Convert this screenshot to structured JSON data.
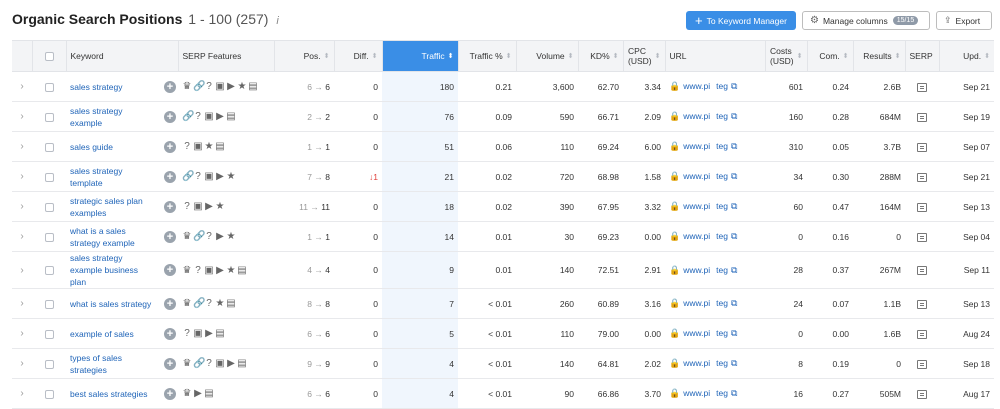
{
  "header": {
    "title": "Organic Search Positions",
    "range": "1 - 100 (257)",
    "info_icon": "i",
    "keyword_manager_label": "To Keyword Manager",
    "manage_columns_label": "Manage columns",
    "manage_columns_count": "15/15",
    "export_label": "Export"
  },
  "columns": {
    "keyword": "Keyword",
    "serp_features": "SERP Features",
    "pos": "Pos.",
    "diff": "Diff.",
    "traffic": "Traffic",
    "traffic_pct": "Traffic %",
    "volume": "Volume",
    "kd": "KD%",
    "cpc_line1": "CPC",
    "cpc_line2": "(USD)",
    "url": "URL",
    "costs_line1": "Costs",
    "costs_line2": "(USD)",
    "com": "Com.",
    "results": "Results",
    "serp": "SERP",
    "upd": "Upd."
  },
  "rows": [
    {
      "keyword": "sales strategy",
      "features": [
        "crown",
        "link",
        "question",
        "image",
        "play",
        "star",
        "serp-box"
      ],
      "pos_prev": "6",
      "arrow": "→",
      "pos_cur": "6",
      "diff": "0",
      "diff_dir": "none",
      "traffic": "180",
      "traffic_pct": "0.21",
      "volume": "3,600",
      "kd": "62.70",
      "cpc": "3.34",
      "url_a": "www.pi",
      "url_b": "teg",
      "costs": "601",
      "com": "0.24",
      "results": "2.6B",
      "upd": "Sep 21"
    },
    {
      "keyword": "sales strategy example",
      "features": [
        "link",
        "question",
        "image",
        "play",
        "serp-box"
      ],
      "pos_prev": "2",
      "arrow": "→",
      "pos_cur": "2",
      "diff": "0",
      "diff_dir": "none",
      "traffic": "76",
      "traffic_pct": "0.09",
      "volume": "590",
      "kd": "66.71",
      "cpc": "2.09",
      "url_a": "www.pi",
      "url_b": "teg",
      "costs": "160",
      "com": "0.28",
      "results": "684M",
      "upd": "Sep 19"
    },
    {
      "keyword": "sales guide",
      "features": [
        "question",
        "image",
        "star",
        "serp-box"
      ],
      "pos_prev": "1",
      "arrow": "→",
      "pos_cur": "1",
      "diff": "0",
      "diff_dir": "none",
      "traffic": "51",
      "traffic_pct": "0.06",
      "volume": "110",
      "kd": "69.24",
      "cpc": "6.00",
      "url_a": "www.pi",
      "url_b": "teg",
      "costs": "310",
      "com": "0.05",
      "results": "3.7B",
      "upd": "Sep 07"
    },
    {
      "keyword": "sales strategy template",
      "features": [
        "link",
        "question",
        "image",
        "play",
        "star"
      ],
      "pos_prev": "7",
      "arrow": "→",
      "pos_cur": "8",
      "diff": "↓1",
      "diff_dir": "down",
      "traffic": "21",
      "traffic_pct": "0.02",
      "volume": "720",
      "kd": "68.98",
      "cpc": "1.58",
      "url_a": "www.pi",
      "url_b": "teg",
      "costs": "34",
      "com": "0.30",
      "results": "288M",
      "upd": "Sep 21"
    },
    {
      "keyword": "strategic sales plan examples",
      "features": [
        "question",
        "image",
        "play",
        "star"
      ],
      "pos_prev": "11",
      "arrow": "→",
      "pos_cur": "11",
      "diff": "0",
      "diff_dir": "none",
      "traffic": "18",
      "traffic_pct": "0.02",
      "volume": "390",
      "kd": "67.95",
      "cpc": "3.32",
      "url_a": "www.pi",
      "url_b": "teg",
      "costs": "60",
      "com": "0.47",
      "results": "164M",
      "upd": "Sep 13"
    },
    {
      "keyword": "what is a sales strategy example",
      "features": [
        "crown",
        "link",
        "question",
        "play",
        "star"
      ],
      "pos_prev": "1",
      "arrow": "→",
      "pos_cur": "1",
      "diff": "0",
      "diff_dir": "none",
      "traffic": "14",
      "traffic_pct": "0.01",
      "volume": "30",
      "kd": "69.23",
      "cpc": "0.00",
      "url_a": "www.pi",
      "url_b": "teg",
      "costs": "0",
      "com": "0.16",
      "results": "0",
      "upd": "Sep 04"
    },
    {
      "keyword": "sales strategy example business plan",
      "features": [
        "crown",
        "question",
        "image",
        "play",
        "star",
        "serp-box"
      ],
      "pos_prev": "4",
      "arrow": "→",
      "pos_cur": "4",
      "diff": "0",
      "diff_dir": "none",
      "traffic": "9",
      "traffic_pct": "0.01",
      "volume": "140",
      "kd": "72.51",
      "cpc": "2.91",
      "url_a": "www.pi",
      "url_b": "teg",
      "costs": "28",
      "com": "0.37",
      "results": "267M",
      "upd": "Sep 11"
    },
    {
      "keyword": "what is sales strategy",
      "features": [
        "crown",
        "link",
        "question",
        "star",
        "serp-box"
      ],
      "pos_prev": "8",
      "arrow": "→",
      "pos_cur": "8",
      "diff": "0",
      "diff_dir": "none",
      "traffic": "7",
      "traffic_pct": "< 0.01",
      "volume": "260",
      "kd": "60.89",
      "cpc": "3.16",
      "url_a": "www.pi",
      "url_b": "teg",
      "costs": "24",
      "com": "0.07",
      "results": "1.1B",
      "upd": "Sep 13"
    },
    {
      "keyword": "example of sales",
      "features": [
        "question",
        "image",
        "play",
        "serp-box"
      ],
      "pos_prev": "6",
      "arrow": "→",
      "pos_cur": "6",
      "diff": "0",
      "diff_dir": "none",
      "traffic": "5",
      "traffic_pct": "< 0.01",
      "volume": "110",
      "kd": "79.00",
      "cpc": "0.00",
      "url_a": "www.pi",
      "url_b": "teg",
      "costs": "0",
      "com": "0.00",
      "results": "1.6B",
      "upd": "Aug 24"
    },
    {
      "keyword": "types of sales strategies",
      "features": [
        "crown",
        "link",
        "question",
        "image",
        "play",
        "serp-box"
      ],
      "pos_prev": "9",
      "arrow": "→",
      "pos_cur": "9",
      "diff": "0",
      "diff_dir": "none",
      "traffic": "4",
      "traffic_pct": "< 0.01",
      "volume": "140",
      "kd": "64.81",
      "cpc": "2.02",
      "url_a": "www.pi",
      "url_b": "teg",
      "costs": "8",
      "com": "0.19",
      "results": "0",
      "upd": "Sep 18"
    },
    {
      "keyword": "best sales strategies",
      "features": [
        "crown",
        "play",
        "serp-box"
      ],
      "pos_prev": "6",
      "arrow": "→",
      "pos_cur": "6",
      "diff": "0",
      "diff_dir": "none",
      "traffic": "4",
      "traffic_pct": "< 0.01",
      "volume": "90",
      "kd": "66.86",
      "cpc": "3.70",
      "url_a": "www.pi",
      "url_b": "teg",
      "costs": "16",
      "com": "0.27",
      "results": "505M",
      "upd": "Aug 17"
    }
  ],
  "colors": {
    "accent": "#3a8ee6",
    "link": "#1f64b8",
    "negative": "#e0423c"
  }
}
